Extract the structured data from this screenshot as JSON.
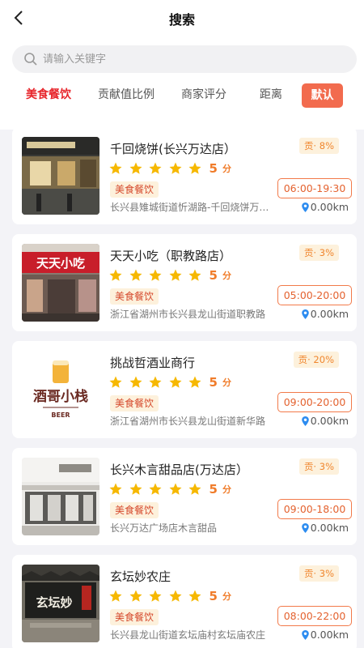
{
  "header": {
    "title": "搜索"
  },
  "search": {
    "placeholder": "请输入关键字",
    "value": ""
  },
  "tabs": [
    {
      "label": "美食餐饮"
    },
    {
      "label": "贡献值比例"
    },
    {
      "label": "商家评分"
    },
    {
      "label": "距离"
    },
    {
      "label": "默认"
    }
  ],
  "colors": {
    "accent": "#e7242a",
    "button": "#f26b4e",
    "star": "#f6b800",
    "score": "#f07c2a",
    "pin": "#2d8cf0"
  },
  "stores": [
    {
      "name": "千回烧饼(长兴万达店）",
      "score": "5",
      "unit": "分",
      "rating": 5,
      "category": "美食餐饮",
      "address": "长兴县雉城街道忻湖路-千回烧饼万达店",
      "contribution": "贡· 8%",
      "hours": "06:00-19:30",
      "distance": "0.00km"
    },
    {
      "name": "天天小吃（职教路店）",
      "score": "5",
      "unit": "分",
      "rating": 5,
      "category": "美食餐饮",
      "address": "浙江省湖州市长兴县龙山街道职教路",
      "contribution": "贡· 3%",
      "hours": "05:00-20:00",
      "distance": "0.00km"
    },
    {
      "name": "挑战哲酒业商行",
      "score": "5",
      "unit": "分",
      "rating": 5,
      "category": "美食餐饮",
      "address": "浙江省湖州市长兴县龙山街道新华路",
      "contribution": "贡· 20%",
      "hours": "09:00-20:00",
      "distance": "0.00km",
      "logo_text": "酒哥小栈",
      "logo_sub": "BEER"
    },
    {
      "name": "长兴木言甜品店(万达店）",
      "score": "5",
      "unit": "分",
      "rating": 5,
      "category": "美食餐饮",
      "address": "长兴万达广场店木言甜品",
      "contribution": "贡· 3%",
      "hours": "09:00-18:00",
      "distance": "0.00km"
    },
    {
      "name": "玄坛妙农庄",
      "score": "5",
      "unit": "分",
      "rating": 5,
      "category": "美食餐饮",
      "address": "长兴县龙山街道玄坛庙村玄坛庙农庄",
      "contribution": "贡· 3%",
      "hours": "08:00-22:00",
      "distance": "0.00km"
    }
  ],
  "icons": {
    "back": "chevron-left-icon",
    "search": "search-icon",
    "star": "star-icon",
    "location": "location-pin-icon"
  }
}
